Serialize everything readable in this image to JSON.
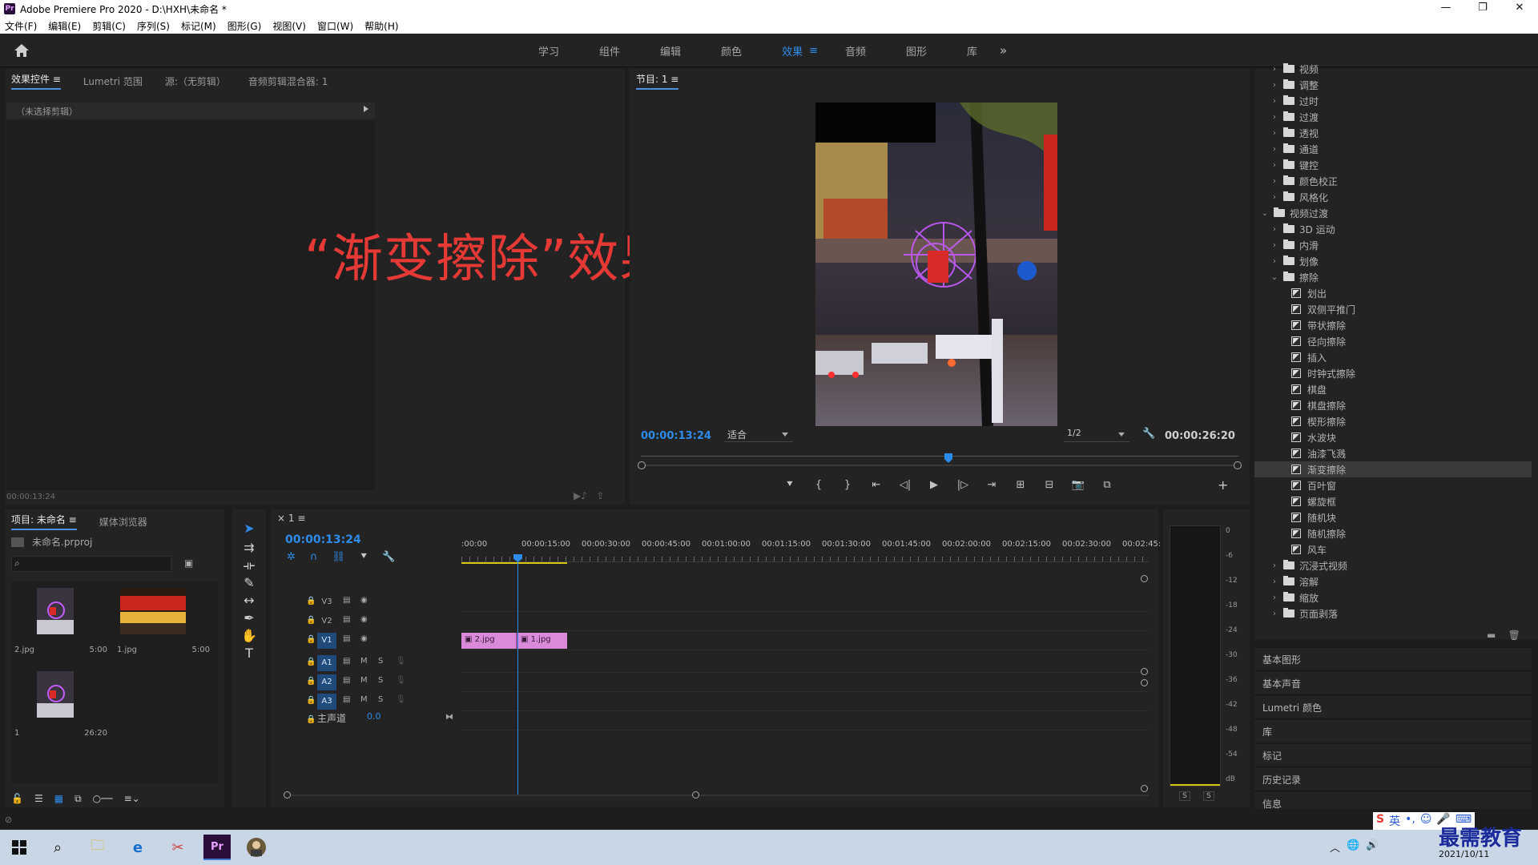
{
  "window": {
    "title": "Adobe Premiere Pro 2020 - D:\\HXH\\未命名 *",
    "app_icon": "Pr",
    "buttons": [
      "—",
      "❐",
      "✕"
    ]
  },
  "menu": [
    "文件(F)",
    "编辑(E)",
    "剪辑(C)",
    "序列(S)",
    "标记(M)",
    "图形(G)",
    "视图(V)",
    "窗口(W)",
    "帮助(H)"
  ],
  "workspaces": {
    "tabs": [
      "学习",
      "组件",
      "编辑",
      "颜色",
      "效果",
      "音频",
      "图形",
      "库"
    ],
    "active": "效果",
    "more": "»"
  },
  "effect_controls": {
    "tabs": [
      "效果控件 ≡",
      "Lumetri 范围",
      "源:（无剪辑）",
      "音频剪辑混合器: 1"
    ],
    "no_clip": "（未选择剪辑）",
    "time": "00:00:13:24"
  },
  "overlay": "“渐变擦除”效果",
  "program": {
    "title": "节目: 1  ≡",
    "timecode_current": "00:00:13:24",
    "fit": "适合",
    "resolution": "1/2",
    "timecode_duration": "00:00:26:20",
    "controls": [
      "⯆",
      "{",
      "}",
      "⇤",
      "◁|",
      "▶",
      "|▷",
      "⇥",
      "⊞",
      "⊟",
      "📷",
      "⧉"
    ],
    "add": "+"
  },
  "effects_list": [
    {
      "type": "folder",
      "label": "视频",
      "level": 1,
      "open": false
    },
    {
      "type": "folder",
      "label": "调整",
      "level": 1,
      "open": false
    },
    {
      "type": "folder",
      "label": "过时",
      "level": 1,
      "open": false
    },
    {
      "type": "folder",
      "label": "过渡",
      "level": 1,
      "open": false
    },
    {
      "type": "folder",
      "label": "透视",
      "level": 1,
      "open": false
    },
    {
      "type": "folder",
      "label": "通道",
      "level": 1,
      "open": false
    },
    {
      "type": "folder",
      "label": "键控",
      "level": 1,
      "open": false
    },
    {
      "type": "folder",
      "label": "颜色校正",
      "level": 1,
      "open": false
    },
    {
      "type": "folder",
      "label": "风格化",
      "level": 1,
      "open": false
    },
    {
      "type": "folder",
      "label": "视频过渡",
      "level": 0,
      "open": true
    },
    {
      "type": "folder",
      "label": "3D 运动",
      "level": 1,
      "open": false
    },
    {
      "type": "folder",
      "label": "内滑",
      "level": 1,
      "open": false
    },
    {
      "type": "folder",
      "label": "划像",
      "level": 1,
      "open": false
    },
    {
      "type": "folder",
      "label": "擦除",
      "level": 1,
      "open": true
    },
    {
      "type": "effect",
      "label": "划出"
    },
    {
      "type": "effect",
      "label": "双侧平推门"
    },
    {
      "type": "effect",
      "label": "带状擦除"
    },
    {
      "type": "effect",
      "label": "径向擦除"
    },
    {
      "type": "effect",
      "label": "插入"
    },
    {
      "type": "effect",
      "label": "时钟式擦除"
    },
    {
      "type": "effect",
      "label": "棋盘"
    },
    {
      "type": "effect",
      "label": "棋盘擦除"
    },
    {
      "type": "effect",
      "label": "楔形擦除"
    },
    {
      "type": "effect",
      "label": "水波块"
    },
    {
      "type": "effect",
      "label": "油漆飞溅"
    },
    {
      "type": "effect",
      "label": "渐变擦除",
      "selected": true
    },
    {
      "type": "effect",
      "label": "百叶窗"
    },
    {
      "type": "effect",
      "label": "螺旋框"
    },
    {
      "type": "effect",
      "label": "随机块"
    },
    {
      "type": "effect",
      "label": "随机擦除"
    },
    {
      "type": "effect",
      "label": "风车"
    },
    {
      "type": "folder",
      "label": "沉浸式视频",
      "level": 1,
      "open": false
    },
    {
      "type": "folder",
      "label": "溶解",
      "level": 1,
      "open": false
    },
    {
      "type": "folder",
      "label": "缩放",
      "level": 1,
      "open": false
    },
    {
      "type": "folder",
      "label": "页面剥落",
      "level": 1,
      "open": false
    }
  ],
  "right_panels": [
    "基本图形",
    "基本声音",
    "Lumetri 颜色",
    "库",
    "标记",
    "历史记录",
    "信息"
  ],
  "project": {
    "tabs": [
      "项目: 未命名  ≡",
      "媒体浏览器"
    ],
    "file": "未命名.prproj",
    "search_placeholder": "",
    "items": [
      {
        "name": "2.jpg",
        "duration": "5:00"
      },
      {
        "name": "1.jpg",
        "duration": "5:00"
      },
      {
        "name": "1",
        "duration": "26:20"
      }
    ]
  },
  "timeline": {
    "tab": "× 1 ≡",
    "timecode": "00:00:13:24",
    "ruler_labels": [
      ":00:00",
      "00:00:15:00",
      "00:00:30:00",
      "00:00:45:00",
      "00:01:00:00",
      "00:01:15:00",
      "00:01:30:00",
      "00:01:45:00",
      "00:02:00:00",
      "00:02:15:00",
      "00:02:30:00",
      "00:02:45:"
    ],
    "video_tracks": [
      "V3",
      "V2",
      "V1"
    ],
    "audio_tracks": [
      "A1",
      "A2",
      "A3"
    ],
    "master": {
      "label": "主声道",
      "value": "0.0"
    },
    "clips": [
      {
        "label": "2.jpg"
      },
      {
        "label": "1.jpg"
      }
    ]
  },
  "audio_meter": {
    "scale": [
      "0",
      "-6",
      "-12",
      "-18",
      "-24",
      "-30",
      "-36",
      "-42",
      "-48",
      "-54",
      "dB"
    ],
    "solo": [
      "S",
      "S"
    ]
  },
  "taskbar": {
    "date": "2021/10/11",
    "watermark": "最需教育",
    "ime_lang": "英"
  },
  "colors": {
    "accent": "#2d8ceb",
    "clip": "#d98ad9",
    "overlay_text": "#e53935",
    "work_area": "#d6c80c"
  }
}
